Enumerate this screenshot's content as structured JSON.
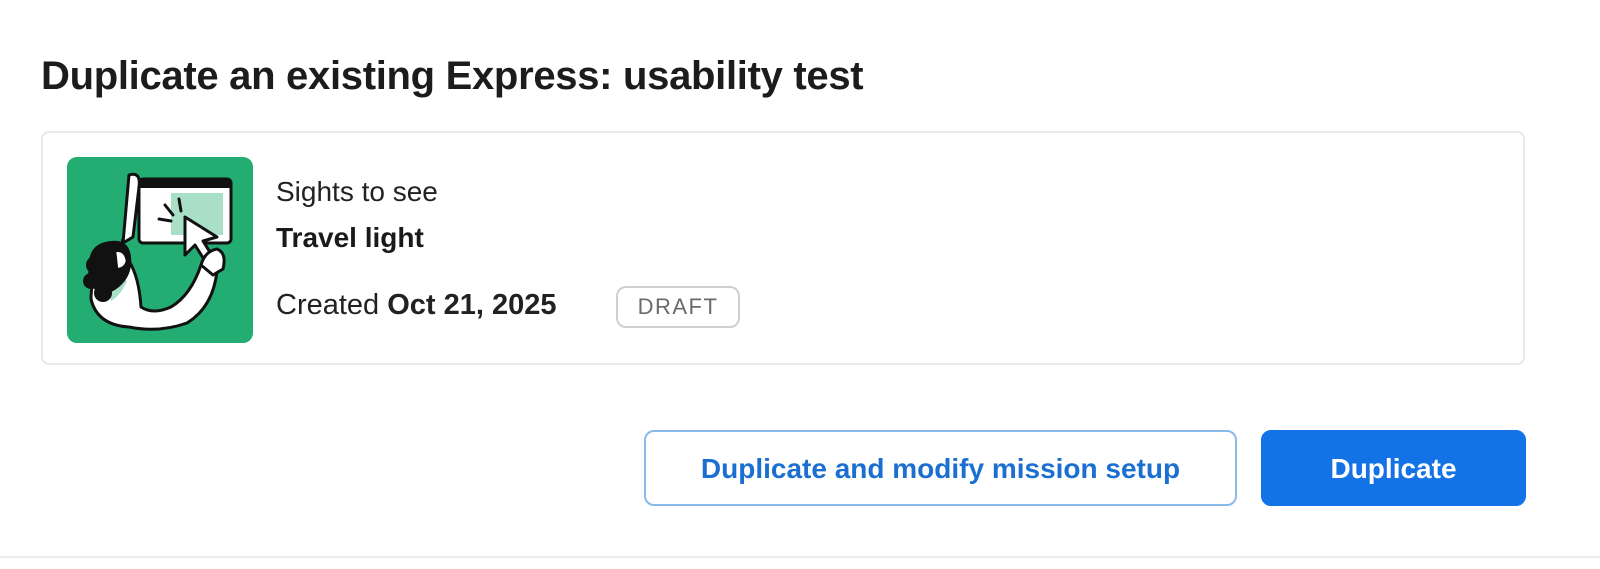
{
  "dialog": {
    "title": "Duplicate an existing Express: usability test"
  },
  "mission": {
    "kicker": "Sights to see",
    "name": "Travel light",
    "created_label": "Created",
    "created_date": "Oct 21, 2025",
    "status_badge": "DRAFT",
    "thumbnail_icon": "person-clicking-screen-illustration",
    "thumbnail_color": "#23ad73"
  },
  "actions": {
    "secondary_label": "Duplicate and modify mission setup",
    "primary_label": "Duplicate",
    "primary_color": "#1373e6",
    "secondary_text_color": "#1b6fd1"
  }
}
